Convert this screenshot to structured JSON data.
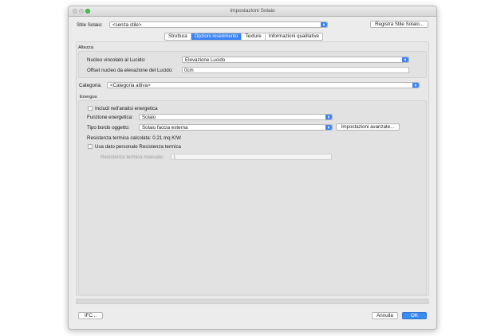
{
  "window": {
    "title": "Impostazioni Solaio"
  },
  "style": {
    "label": "Stile Solaio:",
    "value": "<senza stile>",
    "save_button": "Registra Stile Solaio..."
  },
  "tabs": [
    {
      "label": "Struttura",
      "active": false
    },
    {
      "label": "Opzioni inserimento",
      "active": true
    },
    {
      "label": "Texture",
      "active": false
    },
    {
      "label": "Informazioni qualitative",
      "active": false
    }
  ],
  "altezza": {
    "title": "Altezza",
    "nucleo_label": "Nucleo vincolato al Lucido:",
    "nucleo_value": "Elevazione Lucido",
    "offset_label": "Offset nucleo da elevazione del Lucido:",
    "offset_value": "0cm"
  },
  "categoria": {
    "label": "Categoria:",
    "value": "<Categoria attiva>"
  },
  "energos": {
    "title": "Energos",
    "includi_label": "Includi nell'analisi energetica",
    "funzione_label": "Funzione energetica:",
    "funzione_value": "Solaio",
    "bordo_label": "Tipo bordo oggetto:",
    "bordo_value": "Solaio faccia esterna",
    "advanced_button": "Impostazioni avanzate...",
    "resistenza_text": "Resistenza termica calcolata: 0.21 mq K/W",
    "usa_label": "Usa dato personale Resistenza termica",
    "manuale_label": "Resistenza termica manuale:",
    "manuale_value": "1"
  },
  "footer": {
    "ifc_button": "IFC...",
    "cancel_button": "Annulla",
    "ok_button": "OK"
  },
  "colors": {
    "accent": "#3b82f6"
  }
}
